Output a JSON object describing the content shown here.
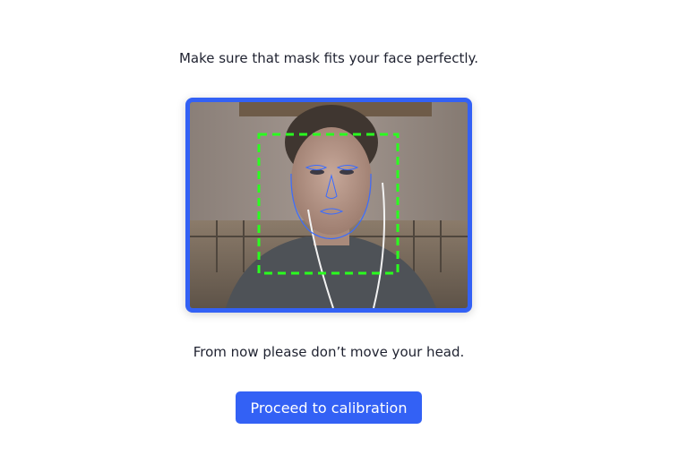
{
  "instructions": {
    "top": "Make sure that mask fits your face perfectly.",
    "bottom": "From now please don’t move your head."
  },
  "camera": {
    "frame_color": "#3361f5",
    "face_box_color": "#2aff1f",
    "mask_color": "#3b6cff"
  },
  "actions": {
    "proceed_label": "Proceed to calibration"
  }
}
